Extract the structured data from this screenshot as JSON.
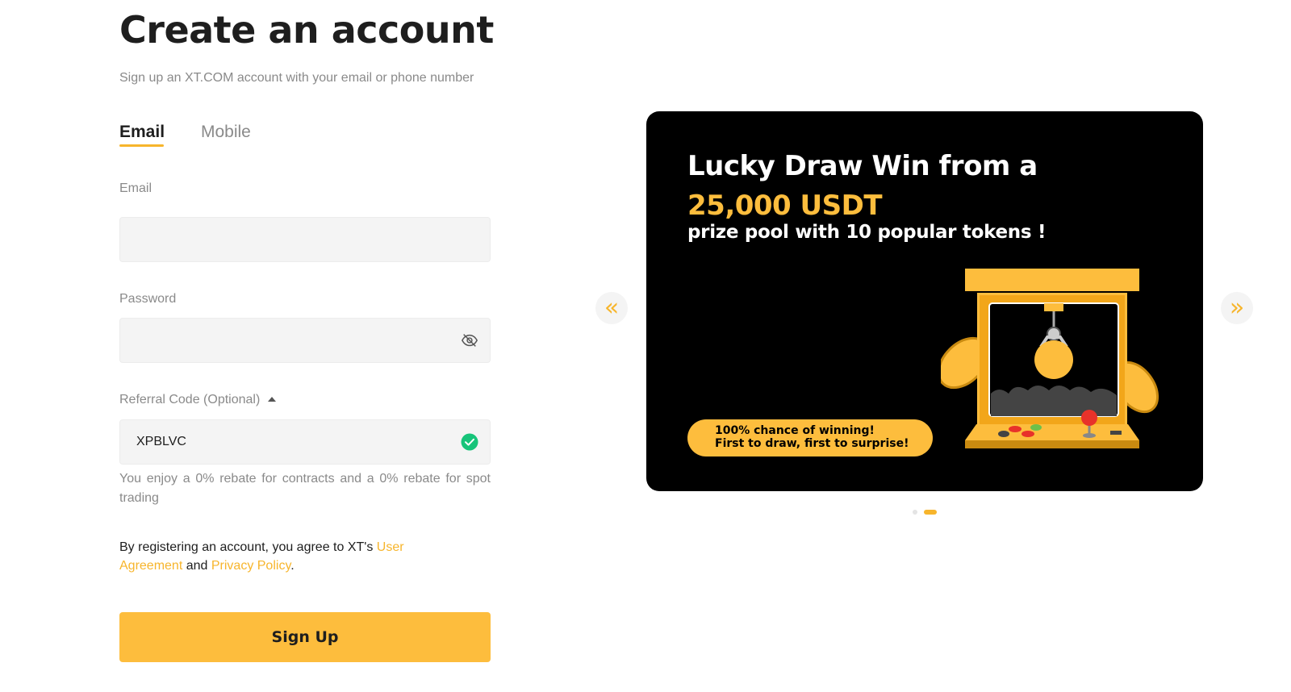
{
  "header": {
    "title": "Create an account",
    "subtitle": "Sign up an XT.COM account with your email or phone number"
  },
  "tabs": [
    {
      "label": "Email",
      "active": true
    },
    {
      "label": "Mobile",
      "active": false
    }
  ],
  "form": {
    "email_label": "Email",
    "email_value": "",
    "password_label": "Password",
    "password_value": "",
    "referral_label": "Referral Code (Optional)",
    "referral_value": "XPBLVC",
    "rebate_text": "You enjoy a 0% rebate for contracts and a 0% rebate for spot trading",
    "agree_prefix": "By registering an account, you agree to XT's ",
    "user_agreement": "User Agreement",
    "agree_and": " and ",
    "privacy_policy": "Privacy Policy",
    "agree_suffix": ".",
    "signup_label": "Sign Up"
  },
  "banner": {
    "line1": "Lucky Draw  Win from a",
    "line2": "25,000 USDT",
    "line3": "prize pool with 10 popular tokens !",
    "pill_line1": "100% chance of winning!",
    "pill_line2": "First to draw, first to surprise!"
  },
  "carousel": {
    "prev_icon": "double-chevron-left-icon",
    "next_icon": "double-chevron-right-icon",
    "slide_count": 2,
    "active_slide": 2
  },
  "colors": {
    "accent": "#fdbd3d",
    "link": "#f7b52c",
    "success": "#17c47a",
    "field_bg": "#f4f4f4"
  }
}
